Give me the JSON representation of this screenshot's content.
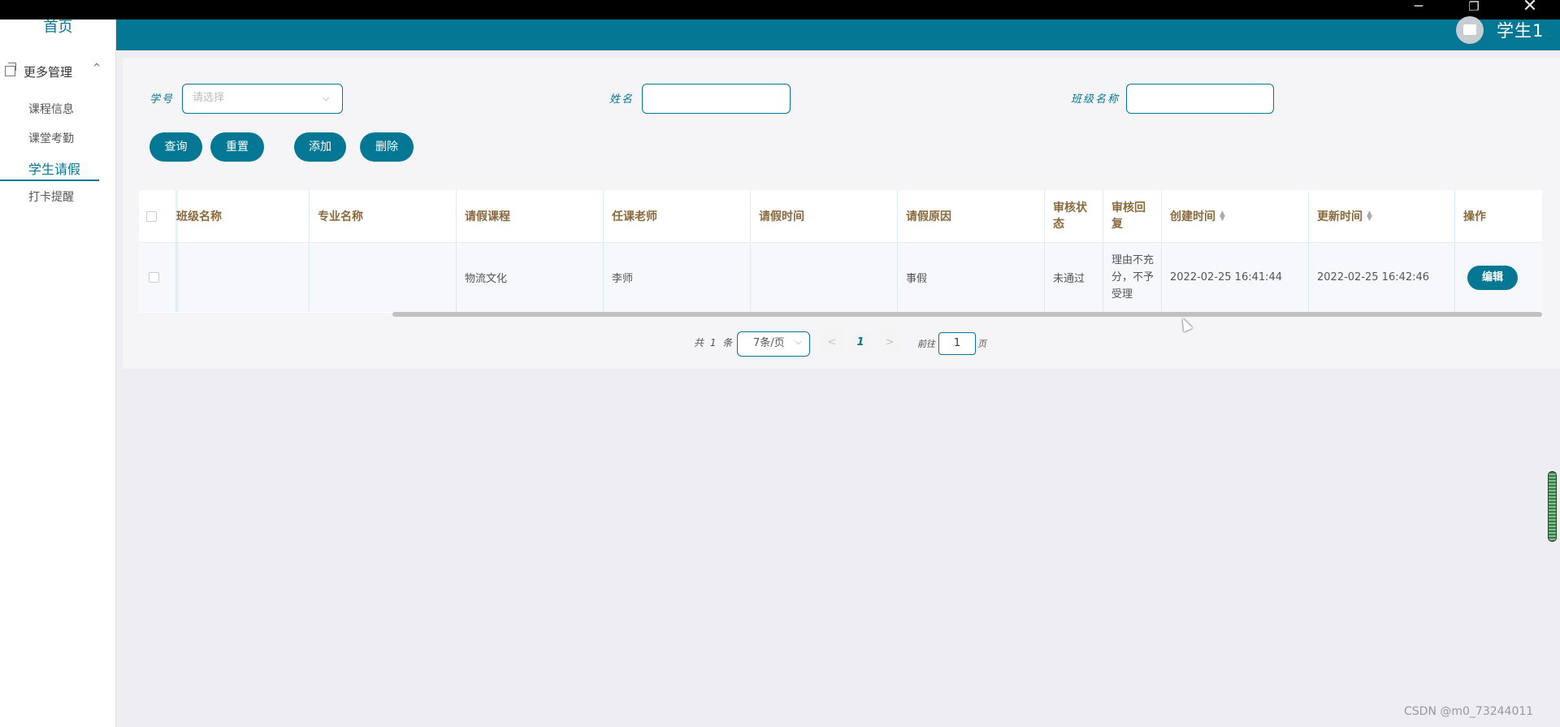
{
  "window": {
    "min_icon": "─",
    "max_icon": "❐",
    "close_icon": "✕"
  },
  "header": {
    "user_name": "学生1"
  },
  "sidebar": {
    "home": "首页",
    "group_title": "更多管理",
    "group_arrow": "^",
    "items": [
      {
        "label": "课程信息"
      },
      {
        "label": "课堂考勤"
      },
      {
        "label": "学生请假"
      },
      {
        "label": "打卡提醒"
      }
    ],
    "active_index": 2
  },
  "search": {
    "student_id_label": "学号",
    "student_id_placeholder": "请选择",
    "name_label": "姓名",
    "name_value": "",
    "class_label": "班级名称",
    "class_value": ""
  },
  "toolbar": {
    "query": "查询",
    "reset": "重置",
    "add": "添加",
    "delete": "删除"
  },
  "table": {
    "columns": [
      "班级名称",
      "专业名称",
      "请假课程",
      "任课老师",
      "请假时间",
      "请假原因",
      "审核状态",
      "审核回复",
      "创建时间",
      "更新时间",
      "操作"
    ],
    "visible_first_column": "班级名称",
    "rows": [
      {
        "class_name": "",
        "major_name": "",
        "course": "物流文化",
        "teacher": "李师",
        "leave_time": "",
        "reason": "事假",
        "status": "未通过",
        "reply": "理由不充分，不予受理",
        "created": "2022-02-25 16:41:44",
        "updated": "2022-02-25 16:42:46",
        "action": "编辑"
      }
    ]
  },
  "pagination": {
    "total": "共 1 条",
    "page_size": "7条/页",
    "prev": "<",
    "current": "1",
    "next": ">",
    "goto_label": "前往",
    "goto_value": "1",
    "page_suffix": "页"
  },
  "watermark": "CSDN @m0_73244011",
  "colors": {
    "brand": "#037793",
    "header_text": "#8a6a3d"
  }
}
